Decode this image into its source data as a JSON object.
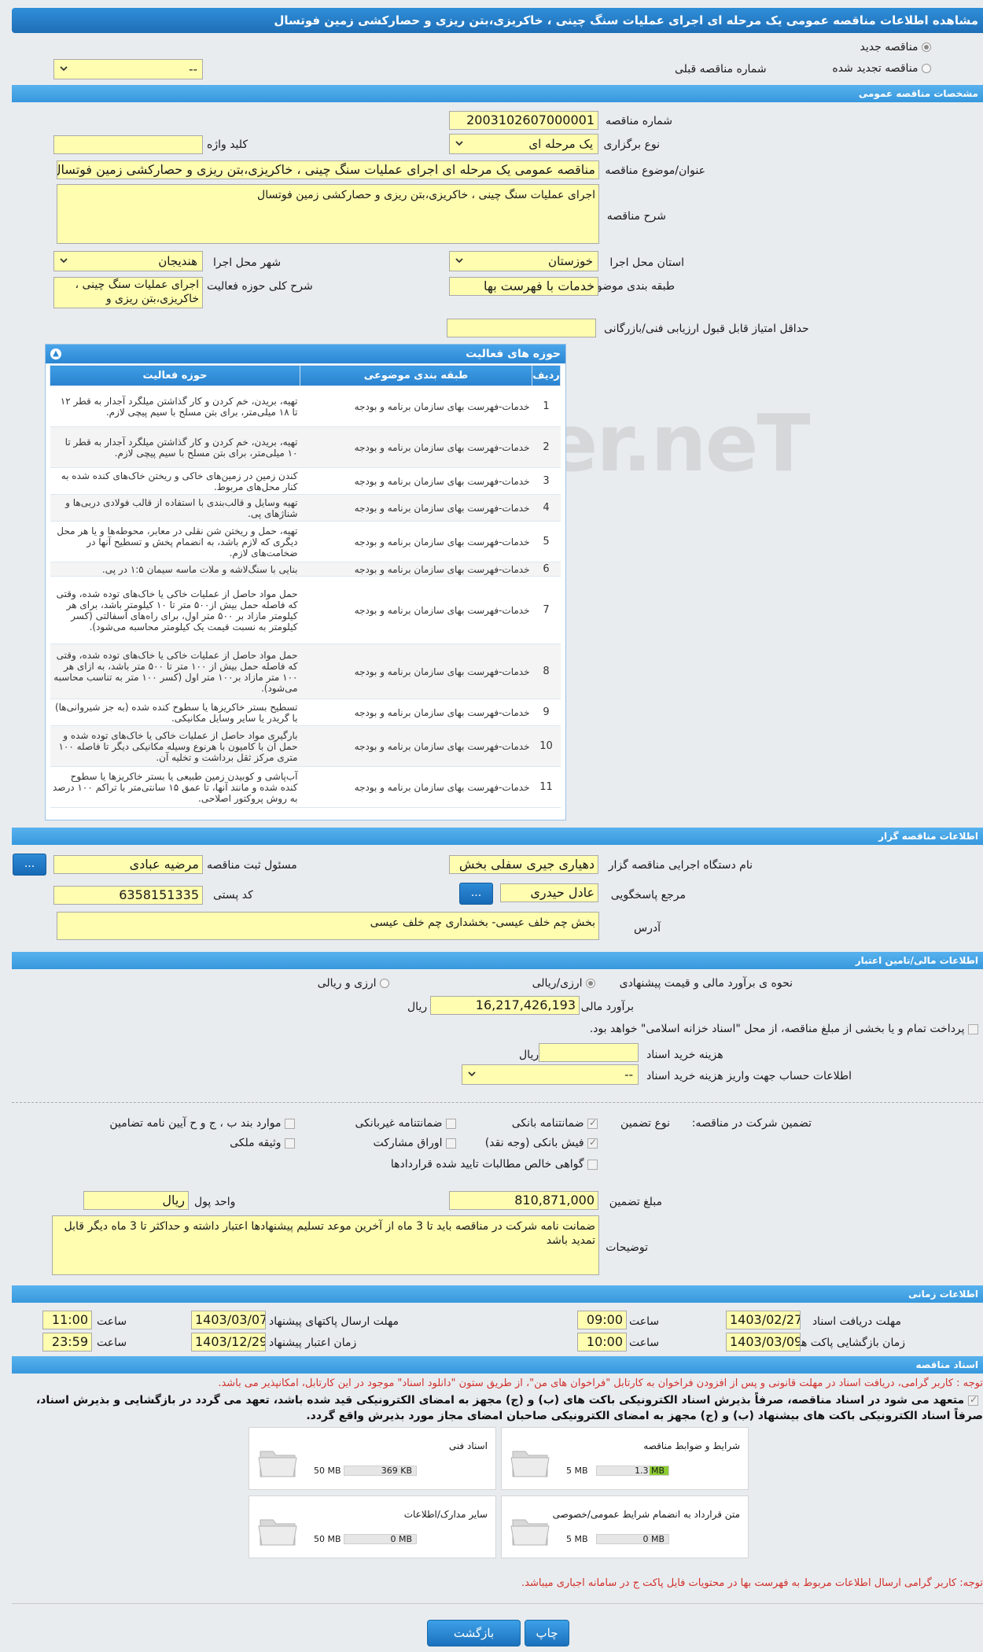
{
  "title": "مشاهده اطلاعات مناقصه عمومی یک مرحله ای اجرای عملیات سنگ چینی ، خاکریزی،بتن ریزی و حصارکشی زمین فوتسال",
  "tender_type": {
    "new_label": "مناقصه جدید",
    "renewed_label": "مناقصه تجدید شده",
    "previous_number_label": "شماره مناقصه قبلی",
    "previous_number_value": "--"
  },
  "general": {
    "section_title": "مشخصات مناقصه عمومی",
    "number_label": "شماره مناقصه",
    "number_value": "2003102607000001",
    "method_label": "نوع برگزاری",
    "method_value": "یک مرحله ای",
    "keyword_label": "کلید واژه",
    "keyword_value": "",
    "subject_label": "عنوان/موضوع مناقصه",
    "subject_value": "مناقصه عمومی یک مرحله ای اجرای عملیات سنگ چینی ، خاکریزی،بتن ریزی و حصارکشی زمین فوتسال",
    "description_label": "شرح مناقصه",
    "description_value": "اجرای عملیات سنگ چینی ، خاکریزی،بتن ریزی و حصارکشی زمین فوتسال",
    "province_label": "استان محل اجرا",
    "province_value": "خوزستان",
    "city_label": "شهر محل اجرا",
    "city_value": "هندیجان",
    "category_label": "طبقه بندی موضوعی",
    "category_value": "خدمات با فهرست بها",
    "activity_desc_label": "شرح کلی حوزه فعالیت",
    "activity_desc_value": "اجرای عملیات سنگ چینی ، خاکریزی،بتن ریزی و",
    "min_score_label": "حداقل امتیاز قابل قبول ارزیابی فنی/بازرگانی",
    "min_score_value": ""
  },
  "activities": {
    "panel_title": "حوزه های فعالیت",
    "headers": [
      "ردیف",
      "طبقه بندی موضوعی",
      "حوزه فعالیت"
    ],
    "rows": [
      {
        "n": "1",
        "cat": "خدمات-فهرست بهای سازمان برنامه و بودجه",
        "area": "تهیه، بریدن، خم کردن و کار گذاشتن میلگرد آجدار به قطر ۱۲ تا ۱۸ میلی‌متر، برای بتن مسلح با سیم پیچی لازم."
      },
      {
        "n": "2",
        "cat": "خدمات-فهرست بهای سازمان برنامه و بودجه",
        "area": "تهیه، بریدن، خم کردن و کار گذاشتن میلگرد آجدار به قطر تا ۱۰ میلی‌متر، برای بتن مسلح با سیم پیچی لازم."
      },
      {
        "n": "3",
        "cat": "خدمات-فهرست بهای سازمان برنامه و بودجه",
        "area": "کندن زمین در زمین‌های خاکی و ریختن خاک‌های کنده شده به کنار محل‌های مربوط."
      },
      {
        "n": "4",
        "cat": "خدمات-فهرست بهای سازمان برنامه و بودجه",
        "area": "تهیه وسایل و قالب‌بندی با استفاده از قالب فولادی دربی‌ها و شناژهای پی."
      },
      {
        "n": "5",
        "cat": "خدمات-فهرست بهای سازمان برنامه و بودجه",
        "area": "تهیه، حمل و ریختن شن نقلی در معابر، محوطه‌ها و یا هر محل دیگری که لازم باشد، به انضمام پخش و تسطیح آنها در ضخامت‌های لازم."
      },
      {
        "n": "6",
        "cat": "خدمات-فهرست بهای سازمان برنامه و بودجه",
        "area": "بنایی با سنگ‌لاشه و ملات ماسه سیمان ۱:۵ در پی."
      },
      {
        "n": "7",
        "cat": "خدمات-فهرست بهای سازمان برنامه و بودجه",
        "area": "حمل مواد حاصل از عملیات خاکی یا خاک‌های توده شده، وقتی که فاصله حمل بیش از۵۰۰ متر تا ۱۰ کیلومتر باشد، برای هر کیلومتر مازاد بر ۵۰۰ متر اول، برای راه‌های آسفالتی (کسر کیلومتر به نسبت قیمت یک کیلومتر محاسبه می‌شود)."
      },
      {
        "n": "8",
        "cat": "خدمات-فهرست بهای سازمان برنامه و بودجه",
        "area": "حمل مواد حاصل از عملیات خاکی یا خاک‌های توده شده، وقتی که فاصله حمل بیش از ۱۰۰ متر تا ۵۰۰ متر باشد، به ازای هر ۱۰۰ متر مازاد بر۱۰۰ متر اول (کسر ۱۰۰ متر به تناسب محاسبه می‌شود)."
      },
      {
        "n": "9",
        "cat": "خدمات-فهرست بهای سازمان برنامه و بودجه",
        "area": "تسطیح بستر خاکریزها یا سطوح کنده شده (به جز شیروانی‌ها) با گریدر یا سایر وسایل مکانیکی."
      },
      {
        "n": "10",
        "cat": "خدمات-فهرست بهای سازمان برنامه و بودجه",
        "area": "بارگیری مواد حاصل از عملیات خاکی یا خاک‌های توده شده و حمل آن با کامیون با هرنوع وسیله مکانیکی دیگر تا فاصله ۱۰۰ متری مرکز ثقل برداشت و تخلیه آن."
      },
      {
        "n": "11",
        "cat": "خدمات-فهرست بهای سازمان برنامه و بودجه",
        "area": "آب‌پاشی و کوبیدن زمین طبیعی یا بستر خاکریزها یا سطوح کنده شده و مانند آنها، تا عمق ۱۵ سانتی‌متر با تراکم ۱۰۰ درصد به روش پروکتور اصلاحی."
      }
    ]
  },
  "organizer": {
    "section_title": "اطلاعات مناقصه گزار",
    "org_label": "نام دستگاه اجرایی مناقصه گزار",
    "org_value": "دهیاری جیری سفلی بخش",
    "registrar_label": "مسئول ثبت مناقصه",
    "registrar_value": "مرضیه عبادی",
    "dots": "...",
    "responder_label": "مرجع پاسخگویی",
    "responder_value": "عادل حیدری",
    "postal_label": "کد پستی",
    "postal_value": "6358151335",
    "address_label": "آدرس",
    "address_value": "بخش چم خلف عیسی- بخشداری چم خلف عیسی"
  },
  "finance": {
    "section_title": "اطلاعات مالی/تامین اعتبار",
    "method_label": "نحوه ی برآورد مالی و قیمت پیشنهادی",
    "opt_rial": "ارزی/ریالی",
    "opt_both": "ارزی و ریالی",
    "estimate_label": "برآورد مالی",
    "estimate_value": "16,217,426,193",
    "rial": "ریال",
    "treasury_text": "پرداخت تمام و یا بخشی از مبلغ مناقصه، از محل \"اسناد خزانه اسلامی\" خواهد بود.",
    "doc_fee_label": "هزینه خرید اسناد",
    "doc_fee_value": "",
    "account_label": "اطلاعات حساب جهت واریز هزینه خرید اسناد",
    "account_value": "--"
  },
  "guarantee": {
    "participation_label": "تضمین شرکت در مناقصه:",
    "type_label": "نوع تضمین",
    "bank_guarantee": "ضمانتنامه بانکی",
    "nonbank_guarantee": "ضمانتنامه غیربانکی",
    "clauses": "موارد بند ب ، ج و ح آیین نامه تضامین",
    "bank_receipt": "فیش بانکی (وجه نقد)",
    "securities": "اوراق مشارکت",
    "property": "وثیقه ملکی",
    "claims": "گواهی خالص مطالبات تایید شده قراردادها",
    "amount_label": "مبلغ تضمین",
    "amount_value": "810,871,000",
    "currency_label": "واحد پول",
    "currency_value": "ریال",
    "notes_label": "توضیحات",
    "notes_value": "ضمانت نامه شرکت در مناقصه باید تا 3 ماه از آخرین موعد تسلیم پیشنهادها اعتبار داشته و حداکثر تا 3 ماه دیگر قابل تمدید باشد"
  },
  "timing": {
    "section_title": "اطلاعات زمانی",
    "receive_label": "مهلت دریافت اسناد",
    "receive_date": "1403/02/27",
    "receive_time": "09:00",
    "send_label": "مهلت ارسال پاکتهای پیشنهاد",
    "send_date": "1403/03/07",
    "send_time": "11:00",
    "open_label": "زمان بازگشایی پاکت ها",
    "open_date": "1403/03/09",
    "open_time": "10:00",
    "validity_label": "زمان اعتبار پیشنهاد",
    "validity_date": "1403/12/29",
    "validity_time": "23:59",
    "time_label": "ساعت"
  },
  "documents": {
    "section_title": "اسناد مناقصه",
    "note1": "توجه : کاربر گرامی، دریافت اسناد در مهلت قانونی و پس از افزودن فراخوان به کارتابل \"فراخوان های من\"، از طریق ستون \"دانلود اسناد\" موجود در این کارتابل، امکانپذیر می باشد.",
    "commit1": "متعهد می شود در اسناد مناقصه، صرفاً بذیرش اسناد الکترونیکی باکت های (ب) و (ج) مجهز به امضای الکترونیکی قید شده باشد، تعهد می گردد در بازگشایی و بذیرش اسناد،",
    "commit2": "صرفاً اسناد الکترونیکی باکت های بیشنهاد (ب) و (ج) مجهز به امضای الکترونیکی صاحبان امضای مجاز مورد بذیرش واقع گردد.",
    "files": [
      {
        "name": "شرایط و ضوابط مناقصه",
        "current": "1.3 MB",
        "max": "5 MB",
        "fill": 0.26
      },
      {
        "name": "اسناد فنی",
        "current": "369 KB",
        "max": "50 MB",
        "fill": 0.0
      },
      {
        "name": "متن قرارداد به انضمام شرایط عمومی/خصوصی",
        "current": "0 MB",
        "max": "5 MB",
        "fill": 0.0
      },
      {
        "name": "سایر مدارک/اطلاعات",
        "current": "0 MB",
        "max": "50 MB",
        "fill": 0.0
      }
    ],
    "note2": "توجه: کاربر گرامی ارسال اطلاعات مربوط به فهرست بها در محتویات فایل پاکت ج در سامانه اجباری میباشد."
  },
  "buttons": {
    "print": "چاپ",
    "back": "بازگشت"
  },
  "watermark": "FriaTender.neT"
}
